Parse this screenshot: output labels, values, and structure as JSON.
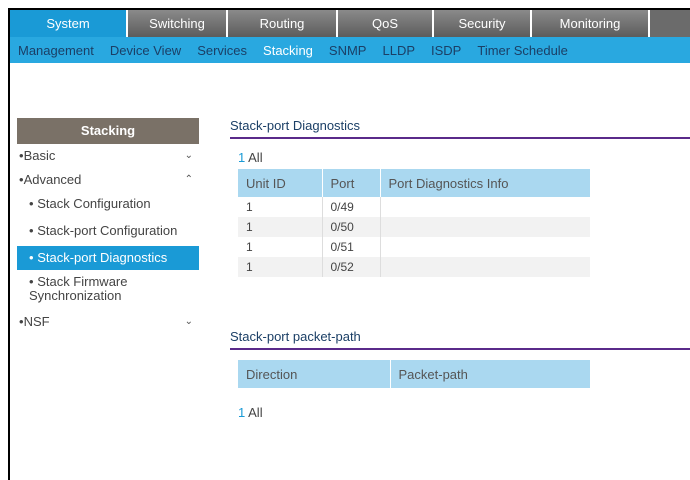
{
  "topnav": [
    "System",
    "Switching",
    "Routing",
    "QoS",
    "Security",
    "Monitoring"
  ],
  "subnav": [
    "Management",
    "Device View",
    "Services",
    "Stacking",
    "SNMP",
    "LLDP",
    "ISDP",
    "Timer Schedule"
  ],
  "sidebar": {
    "header": "Stacking",
    "basic": "Basic",
    "advanced": "Advanced",
    "stack_configuration": "Stack Configuration",
    "stackport_configuration": "Stack-port Configuration",
    "stackport_diagnostics": "Stack-port Diagnostics",
    "stack_firmware_line1": "Stack Firmware",
    "stack_firmware_line2": "Synchronization",
    "nsf": "NSF"
  },
  "diagnostics": {
    "title": "Stack-port Diagnostics",
    "all_count": "1",
    "all_label": "All",
    "columns": [
      "Unit ID",
      "Port",
      "Port Diagnostics Info"
    ],
    "rows": [
      [
        "1",
        "0/49",
        ""
      ],
      [
        "1",
        "0/50",
        ""
      ],
      [
        "1",
        "0/51",
        ""
      ],
      [
        "1",
        "0/52",
        ""
      ]
    ]
  },
  "packetpath": {
    "title": "Stack-port packet-path",
    "columns": [
      "Direction",
      "Packet-path"
    ],
    "all_count": "1",
    "all_label": "All"
  }
}
